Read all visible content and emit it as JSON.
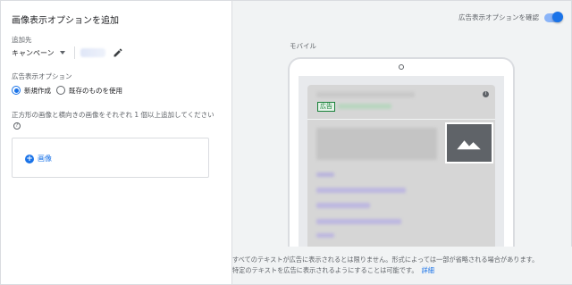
{
  "left_panel": {
    "title": "画像表示オプションを追加",
    "add_to_label": "追加先",
    "campaign_select_value": "キャンペーン",
    "extension_label": "広告表示オプション",
    "radio_new": "新規作成",
    "radio_existing": "既存のものを使用",
    "radio_selected": "新規作成",
    "instruction": "正方形の画像と横向きの画像をそれぞれ 1 個以上追加してください",
    "help_glyph": "?",
    "add_image_label": "画像"
  },
  "right_panel": {
    "preview_toggle_label": "広告表示オプションを確認",
    "preview_toggle_on": true,
    "device_label": "モバイル",
    "ad_badge": "広告",
    "info_glyph": "i",
    "footer_line1": "すべてのテキストが広告に表示されるとは限りません。形式によっては一部が省略される場合があります。",
    "footer_line2": "特定のテキストを広告に表示されるようにすることは可能です。",
    "footer_link": "詳細"
  },
  "colors": {
    "accent": "#1a73e8",
    "ad_green": "#188038",
    "panel_bg": "#f1f3f4"
  },
  "icons": {
    "edit": "pencil-icon",
    "add": "add-circle-icon",
    "image_placeholder": "landscape-image-icon",
    "help": "help-icon",
    "info": "info-icon",
    "dropdown": "caret-down-icon"
  }
}
